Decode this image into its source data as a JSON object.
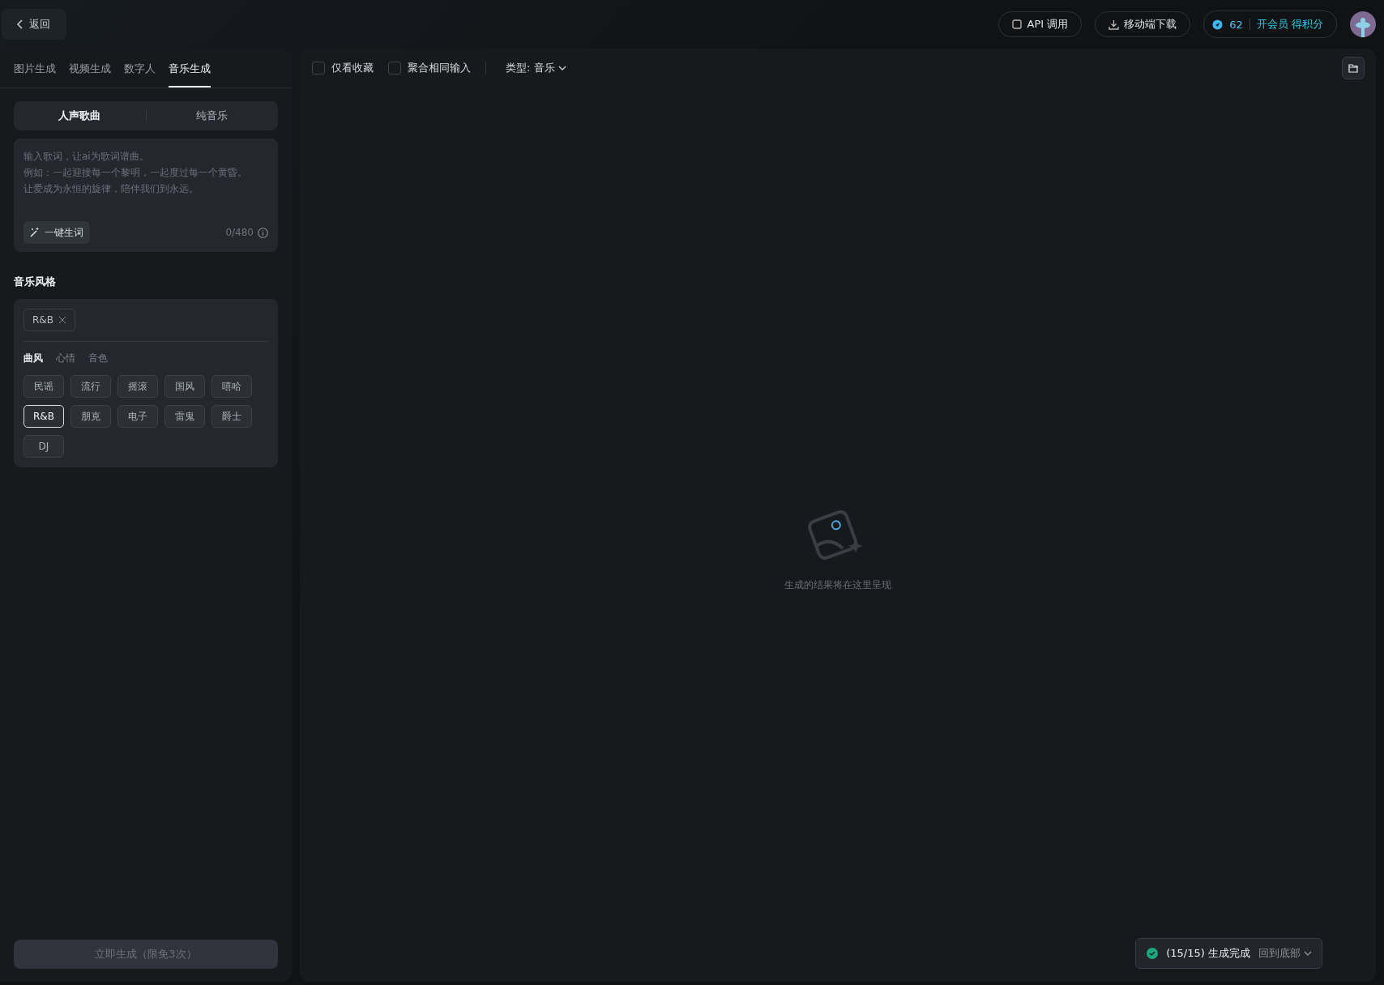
{
  "header": {
    "back": "返回",
    "api_button": "API 调用",
    "download_button": "移动端下载",
    "points": "62",
    "vip_link": "开会员 得积分"
  },
  "sidebar": {
    "tabs": [
      {
        "label": "图片生成",
        "selected": false
      },
      {
        "label": "视频生成",
        "selected": false
      },
      {
        "label": "数字人",
        "selected": false
      },
      {
        "label": "音乐生成",
        "selected": true
      }
    ],
    "modes": [
      {
        "label": "人声歌曲",
        "selected": true
      },
      {
        "label": "纯音乐",
        "selected": false
      }
    ],
    "lyrics": {
      "placeholder": [
        "输入歌词，让ai为歌词谱曲。",
        "例如：一起迎接每一个黎明，一起度过每一个黄昏。",
        "让爱成为永恒的旋律，陪伴我们到永远。"
      ],
      "auto_button": "一键生词",
      "counter": "0/480"
    },
    "style_heading": "音乐风格",
    "selected_tags": [
      "R&B"
    ],
    "categories": [
      {
        "label": "曲风",
        "selected": true
      },
      {
        "label": "心情",
        "selected": false
      },
      {
        "label": "音色",
        "selected": false
      }
    ],
    "genres": [
      {
        "label": "民谣",
        "selected": false
      },
      {
        "label": "流行",
        "selected": false
      },
      {
        "label": "摇滚",
        "selected": false
      },
      {
        "label": "国风",
        "selected": false
      },
      {
        "label": "嘻哈",
        "selected": false
      },
      {
        "label": "R&B",
        "selected": true
      },
      {
        "label": "朋克",
        "selected": false
      },
      {
        "label": "电子",
        "selected": false
      },
      {
        "label": "雷鬼",
        "selected": false
      },
      {
        "label": "爵士",
        "selected": false
      },
      {
        "label": "DJ",
        "selected": false
      }
    ],
    "generate_button": {
      "label": "立即生成（限免3次）",
      "disabled": true
    }
  },
  "results": {
    "filters": [
      {
        "label": "仅看收藏",
        "checked": false
      },
      {
        "label": "聚合相同输入",
        "checked": false
      }
    ],
    "type_dropdown": "类型: 音乐",
    "empty_text": "生成的结果将在这里呈现",
    "toast": {
      "status": "(15/15) 生成完成",
      "link": "回到底部"
    }
  }
}
